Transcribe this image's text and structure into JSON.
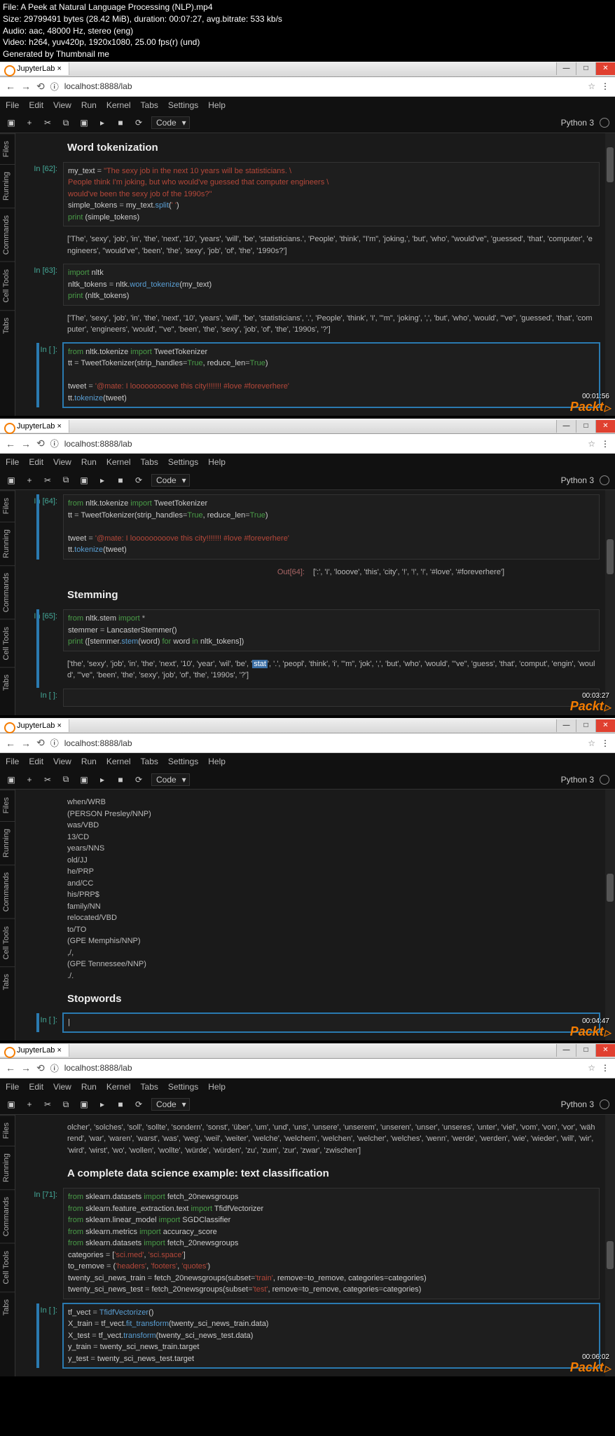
{
  "header": {
    "file": "File: A Peek at Natural Language Processing (NLP).mp4",
    "size": "Size: 29799491 bytes (28.42 MiB), duration: 00:07:27, avg.bitrate: 533 kb/s",
    "audio": "Audio: aac, 48000 Hz, stereo (eng)",
    "video": "Video: h264, yuv420p, 1920x1080, 25.00 fps(r) (und)",
    "gen": "Generated by Thumbnail me"
  },
  "chrome": {
    "tab": "JupyterLab",
    "url": "localhost:8888/lab",
    "nav_back": "←",
    "nav_fwd": "→",
    "reload": "⟲",
    "secure": "ⓘ",
    "star": "☆",
    "menu": "⋮"
  },
  "win": {
    "min": "—",
    "max": "□",
    "close": "✕"
  },
  "menus": [
    "File",
    "Edit",
    "View",
    "Run",
    "Kernel",
    "Tabs",
    "Settings",
    "Help"
  ],
  "tb_icons": [
    "▣",
    "+",
    "✂",
    "⧉",
    "▣",
    "▸",
    "■",
    "⟳"
  ],
  "mode": "Code",
  "kernel": "Python 3",
  "sidetabs": [
    "Files",
    "Running",
    "Commands",
    "Cell Tools",
    "Tabs"
  ],
  "timestamps": [
    "00:01:56",
    "00:03:27",
    "00:04:47",
    "00:06:02"
  ],
  "prompt": {
    "in62": "In [62]:",
    "in63": "In [63]:",
    "in": "In [ ]:",
    "in64": "In [64]:",
    "out64": "Out[64]:",
    "in65": "In [65]:",
    "in71": "In [71]:"
  },
  "p1": {
    "title": "Word tokenization",
    "c62_1a": "my_text ",
    "c62_1b": "= ",
    "c62_1c": "\"The sexy job in the next 10 years will be statisticians. \\",
    "c62_2": "People think I'm joking, but who would've guessed that computer engineers \\",
    "c62_3": "would've been the sexy job of the 1990s?\"",
    "c62_4a": "simple_tokens ",
    "c62_4b": "= ",
    "c62_4c": "my_text.",
    "c62_4d": "split",
    "c62_4e": "(",
    "c62_4f": "' '",
    "c62_4g": ")",
    "c62_5a": "print ",
    "c62_5b": "(simple_tokens)",
    "o62": "['The', 'sexy', 'job', 'in', 'the', 'next', '10', 'years', 'will', 'be', 'statisticians.', 'People', 'think', \"I'm\", 'joking,', 'but', 'who', \"would've\", 'guessed', 'that', 'computer', 'engineers', \"would've\", 'been', 'the', 'sexy', 'job', 'of', 'the', '1990s?']",
    "c63_1a": "import ",
    "c63_1b": "nltk",
    "c63_2a": "nltk_tokens ",
    "c63_2b": "= ",
    "c63_2c": "nltk.",
    "c63_2d": "word_tokenize",
    "c63_2e": "(my_text)",
    "c63_3a": "print ",
    "c63_3b": "(nltk_tokens)",
    "o63": "['The', 'sexy', 'job', 'in', 'the', 'next', '10', 'years', 'will', 'be', 'statisticians', '.', 'People', 'think', 'I', \"'m\", 'joking', ',', 'but', 'who', 'would', \"'ve\", 'guessed', 'that', 'computer', 'engineers', 'would', \"'ve\", 'been', 'the', 'sexy', 'job', 'of', 'the', '1990s', '?']",
    "cactive_1a": "from ",
    "cactive_1b": "nltk.tokenize ",
    "cactive_1c": "import ",
    "cactive_1d": "TweetTokenizer",
    "cactive_2a": "tt ",
    "cactive_2b": "= ",
    "cactive_2c": "TweetTokenizer(strip_handles",
    "cactive_2d": "=",
    "cactive_2e": "True",
    "cactive_2f": ", reduce_len",
    "cactive_2g": "=",
    "cactive_2h": "True",
    "cactive_2i": ")",
    "cactive_3": "",
    "cactive_4a": "tweet ",
    "cactive_4b": "= ",
    "cactive_4c": "'@mate: I looooooooove this city!!!!!!! #love #foreverhere'",
    "cactive_5a": "tt.",
    "cactive_5b": "tokenize",
    "cactive_5c": "(tweet)"
  },
  "p2": {
    "c64_1a": "from ",
    "c64_1b": "nltk.tokenize ",
    "c64_1c": "import ",
    "c64_1d": "TweetTokenizer",
    "c64_2a": "tt ",
    "c64_2b": "= ",
    "c64_2c": "TweetTokenizer(strip_handles",
    "c64_2d": "=",
    "c64_2e": "True",
    "c64_2f": ", reduce_len",
    "c64_2g": "=",
    "c64_2h": "True",
    "c64_2i": ")",
    "c64_3": "",
    "c64_4a": "tweet ",
    "c64_4b": "= ",
    "c64_4c": "'@mate: I looooooooove this city!!!!!!! #love #foreverhere'",
    "c64_5a": "tt.",
    "c64_5b": "tokenize",
    "c64_5c": "(tweet)",
    "o64": "[':', 'I', 'looove', 'this', 'city', '!', '!', '!', '#love', '#foreverhere']",
    "stem": "Stemming",
    "c65_1a": "from ",
    "c65_1b": "nltk.stem ",
    "c65_1c": "import ",
    "c65_1d": "*",
    "c65_2a": "stemmer ",
    "c65_2b": "= ",
    "c65_2c": "LancasterStemmer()",
    "c65_3a": "print ",
    "c65_3b": "([stemmer.",
    "c65_3c": "stem",
    "c65_3d": "(word) ",
    "c65_3e": "for ",
    "c65_3f": "word ",
    "c65_3g": "in ",
    "c65_3h": "nltk_tokens])",
    "o65a": "['the', 'sexy', 'job', 'in', 'the', 'next', '10', 'year', 'wil', 'be', '",
    "o65hl": "stat",
    "o65b": "', '.', 'peopl', 'think', 'i', \"'m\", 'jok', ',', 'but', 'who', 'would', \"'ve\", 'guess', 'that', 'comput', 'engin', 'would', \"'ve\", 'been', 'the', 'sexy', 'job', 'of', 'the', '1990s', '?']"
  },
  "p3": {
    "lines": [
      "when/WRB",
      "(PERSON Presley/NNP)",
      "was/VBD",
      "13/CD",
      "years/NNS",
      "old/JJ",
      "he/PRP",
      "and/CC",
      "his/PRP$",
      "family/NN",
      "relocated/VBD",
      "to/TO",
      "(GPE Memphis/NNP)",
      ",/,",
      "(GPE Tennessee/NNP)",
      "./."
    ],
    "sw": "Stopwords"
  },
  "p4": {
    "stop": "olcher', 'solches', 'soll', 'sollte', 'sondern', 'sonst', 'über', 'um', 'und', 'uns', 'unsere', 'unserem', 'unseren', 'unser', 'unseres', 'unter', 'viel', 'vom', 'von', 'vor', 'während', 'war', 'waren', 'warst', 'was', 'weg', 'weil', 'weiter', 'welche', 'welchem', 'welchen', 'welcher', 'welches', 'wenn', 'werde', 'werden', 'wie', 'wieder', 'will', 'wir', 'wird', 'wirst', 'wo', 'wollen', 'wollte', 'würde', 'würden', 'zu', 'zum', 'zur', 'zwar', 'zwischen']",
    "title": "A complete data science example: text classification",
    "c71_1a": "from ",
    "c71_1b": "sklearn.datasets ",
    "c71_1c": "import ",
    "c71_1d": "fetch_20newsgroups",
    "c71_2a": "from ",
    "c71_2b": "sklearn.feature_extraction.text ",
    "c71_2c": "import ",
    "c71_2d": "TfidfVectorizer",
    "c71_3a": "from ",
    "c71_3b": "sklearn.linear_model ",
    "c71_3c": "import ",
    "c71_3d": "SGDClassifier",
    "c71_4a": "from ",
    "c71_4b": "sklearn.metrics ",
    "c71_4c": "import ",
    "c71_4d": "accuracy_score",
    "c71_5a": "from ",
    "c71_5b": "sklearn.datasets ",
    "c71_5c": "import ",
    "c71_5d": "fetch_20newsgroups",
    "c71_6a": "categories ",
    "c71_6b": "= ",
    "c71_6c": "[",
    "c71_6d": "'sci.med'",
    "c71_6e": ", ",
    "c71_6f": "'sci.space'",
    "c71_6g": "]",
    "c71_7a": "to_remove ",
    "c71_7b": "= ",
    "c71_7c": "(",
    "c71_7d": "'headers'",
    "c71_7e": ", ",
    "c71_7f": "'footers'",
    "c71_7g": ", ",
    "c71_7h": "'quotes'",
    "c71_7i": ")",
    "c71_8a": "twenty_sci_news_train ",
    "c71_8b": "= ",
    "c71_8c": "fetch_20newsgroups(subset",
    "c71_8d": "=",
    "c71_8e": "'train'",
    "c71_8f": ", remove",
    "c71_8g": "=",
    "c71_8h": "to_remove, categories",
    "c71_8i": "=",
    "c71_8j": "categories)",
    "c71_9a": "twenty_sci_news_test ",
    "c71_9b": "= ",
    "c71_9c": "fetch_20newsgroups(subset",
    "c71_9d": "=",
    "c71_9e": "'test'",
    "c71_9f": ", remove",
    "c71_9g": "=",
    "c71_9h": "to_remove, categories",
    "c71_9i": "=",
    "c71_9j": "categories)",
    "ca_1a": "tf_vect ",
    "ca_1b": "= ",
    "ca_1c": "TfidfVectorizer",
    "ca_1d": "()",
    "ca_2a": "X_train ",
    "ca_2b": "= ",
    "ca_2c": "tf_vect.",
    "ca_2d": "fit_transform",
    "ca_2e": "(twenty_sci_news_train.data)",
    "ca_3a": "X_test ",
    "ca_3b": "= ",
    "ca_3c": "tf_vect.",
    "ca_3d": "transform",
    "ca_3e": "(twenty_sci_news_test.data)",
    "ca_4a": "y_train ",
    "ca_4b": "= ",
    "ca_4c": "twenty_sci_news_train.target",
    "ca_5a": "y_test ",
    "ca_5b": "= ",
    "ca_5c": "twenty_sci_news_test.target"
  }
}
